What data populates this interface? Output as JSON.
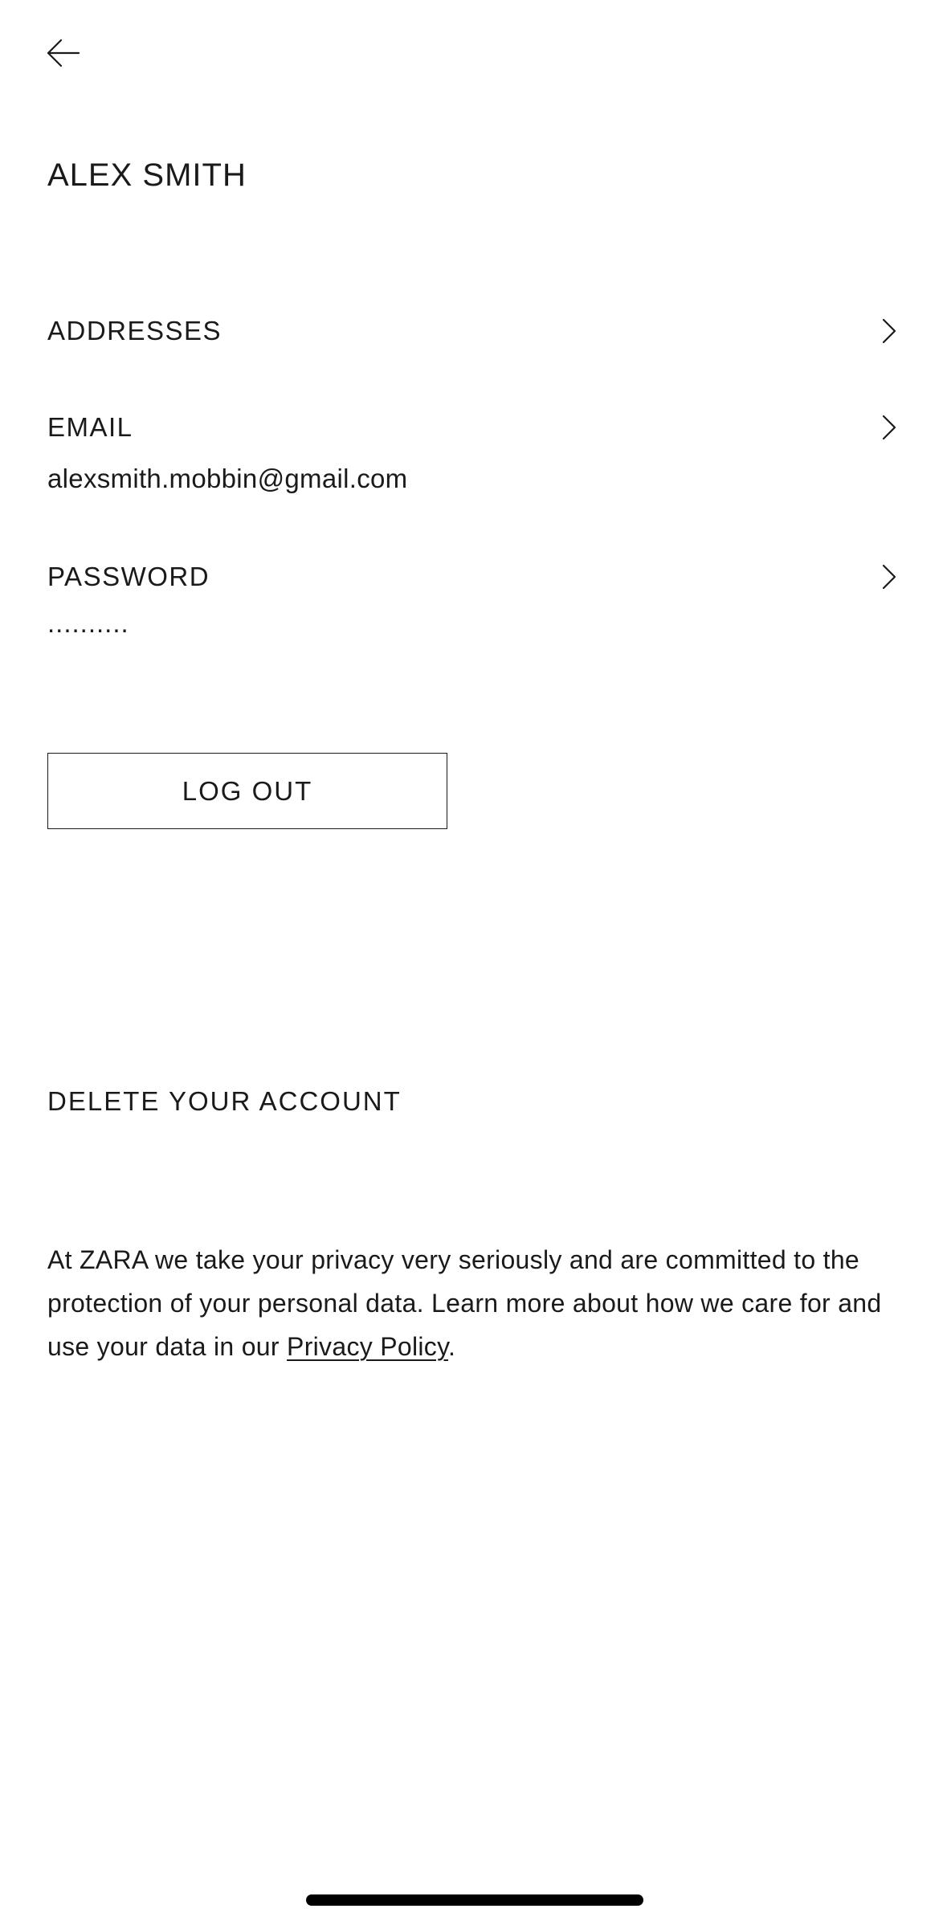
{
  "header": {
    "back_icon": "arrow-left-icon"
  },
  "profile": {
    "name": "ALEX SMITH"
  },
  "settings": {
    "addresses": {
      "label": "ADDRESSES",
      "icon": "chevron-right-icon"
    },
    "email": {
      "label": "EMAIL",
      "value": "alexsmith.mobbin@gmail.com",
      "icon": "chevron-right-icon"
    },
    "password": {
      "label": "PASSWORD",
      "value": "..........",
      "icon": "chevron-right-icon"
    }
  },
  "actions": {
    "logout_label": "LOG OUT",
    "delete_label": "DELETE YOUR ACCOUNT"
  },
  "privacy": {
    "text_before": "At ZARA we take your privacy very seriously and are committed to the protection of your personal data. Learn more about how we care for and use your data in our ",
    "link_label": "Privacy Policy",
    "text_after": "."
  },
  "colors": {
    "background": "#ffffff",
    "text": "#1a1a1a"
  }
}
